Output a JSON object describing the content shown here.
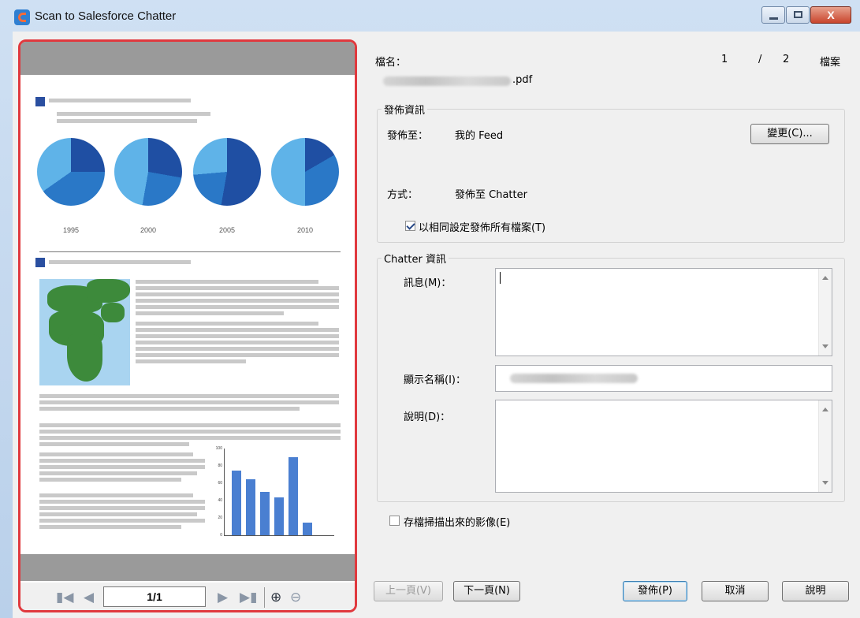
{
  "window": {
    "title": "Scan to Salesforce Chatter",
    "close_glyph": "X"
  },
  "preview": {
    "page_indicator": "1/1",
    "years": [
      "1995",
      "2000",
      "2005",
      "2010"
    ],
    "pie_colors": {
      "light": "#5fb3e8",
      "mid": "#2a78c7",
      "dark": "#1f4fa3"
    },
    "bar_values": [
      75,
      65,
      50,
      44,
      90,
      15
    ],
    "y_ticks": [
      "100",
      "80",
      "60",
      "40",
      "20",
      "0"
    ]
  },
  "file": {
    "label": "檔名：",
    "extension": ".pdf",
    "index": "1",
    "separator": "/",
    "total": "2",
    "unit": "檔案"
  },
  "publish_info": {
    "legend": "發佈資訊",
    "to_label": "發佈至：",
    "to_value": "我的 Feed",
    "change_button": "變更(C)...",
    "method_label": "方式：",
    "method_value": "發佈至 Chatter",
    "apply_all_label": "以相同設定發佈所有檔案(T)",
    "apply_all_checked": true
  },
  "chatter_info": {
    "legend": "Chatter 資訊",
    "message_label": "訊息(M)：",
    "display_name_label": "顯示名稱(I)：",
    "description_label": "說明(D)："
  },
  "save_images_label": "存檔掃描出來的影像(E)",
  "buttons": {
    "prev": "上一頁(V)",
    "next": "下一頁(N)",
    "publish": "發佈(P)",
    "cancel": "取消",
    "help": "說明"
  }
}
